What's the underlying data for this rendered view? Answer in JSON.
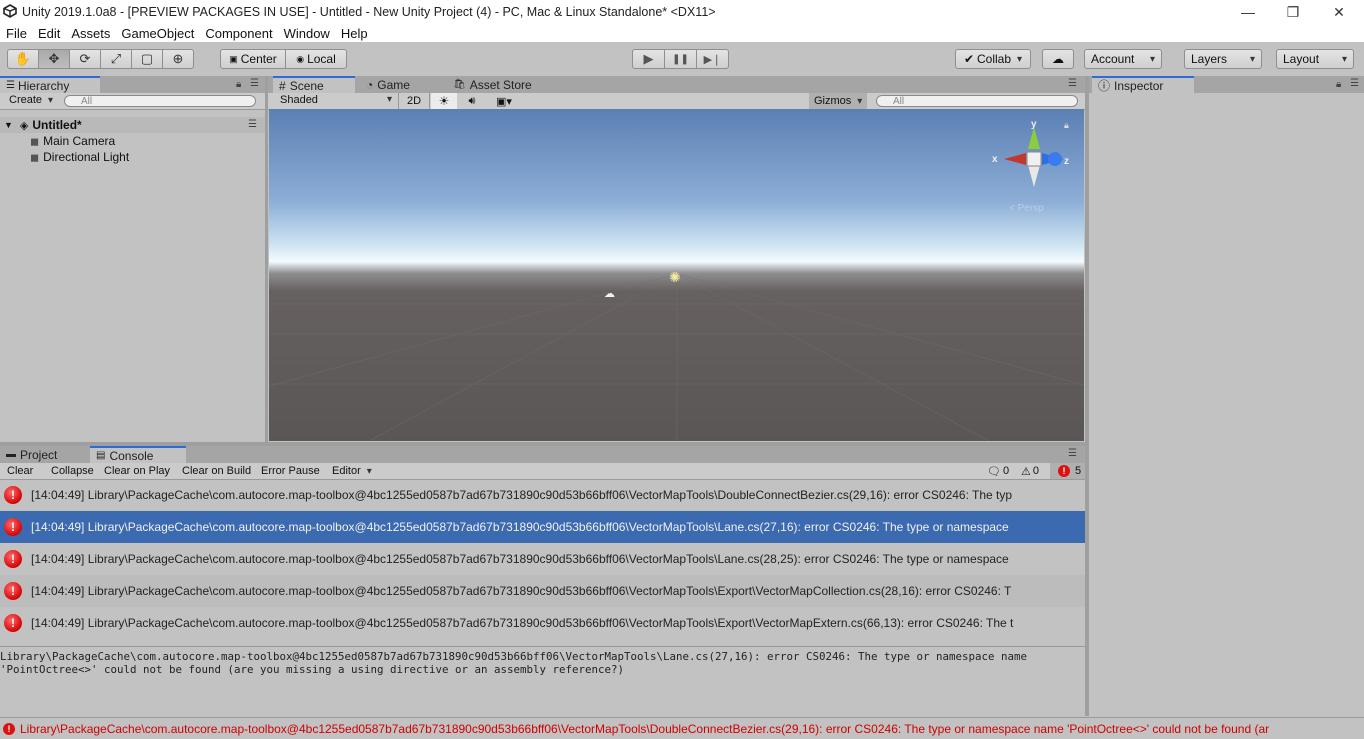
{
  "window": {
    "title": "Unity 2019.1.0a8 - [PREVIEW PACKAGES IN USE] - Untitled - New Unity Project (4) - PC, Mac & Linux Standalone* <DX11>",
    "minimize": "—",
    "restore": "❐",
    "close": "✕"
  },
  "menu": [
    "File",
    "Edit",
    "Assets",
    "GameObject",
    "Component",
    "Window",
    "Help"
  ],
  "toolbar": {
    "tools": [
      "hand-tool-icon",
      "move-tool-icon",
      "rotate-tool-icon",
      "scale-tool-icon",
      "rect-tool-icon",
      "transform-tool-icon"
    ],
    "tool_glyphs": [
      "✋",
      "✥",
      "⟳",
      "⤢",
      "▢",
      "⊕"
    ],
    "pivot_center": "Center",
    "pivot_local": "Local",
    "play": "▶",
    "pause": "❚❚",
    "step": "▶❘",
    "collab": "Collab",
    "cloud": "☁",
    "account": "Account",
    "layers": "Layers",
    "layout": "Layout"
  },
  "hierarchy": {
    "tab": "Hierarchy",
    "create": "Create",
    "search_placeholder": "All",
    "scene_name": "Untitled*",
    "items": [
      "Main Camera",
      "Directional Light"
    ]
  },
  "scene": {
    "tabs": [
      "Scene",
      "Game",
      "Asset Store"
    ],
    "shading": "Shaded",
    "mode_2d": "2D",
    "gizmos": "Gizmos",
    "search_placeholder": "All",
    "axis_y": "y",
    "axis_x": "x",
    "axis_z": "z",
    "persp": "Persp"
  },
  "inspector": {
    "tab": "Inspector"
  },
  "console": {
    "tabs": [
      "Project",
      "Console"
    ],
    "toolbar": [
      "Clear",
      "Collapse",
      "Clear on Play",
      "Clear on Build",
      "Error Pause",
      "Editor"
    ],
    "counts": {
      "info": "0",
      "warn": "0",
      "error": "5"
    },
    "rows": [
      "[14:04:49] Library\\PackageCache\\com.autocore.map-toolbox@4bc1255ed0587b7ad67b731890c90d53b66bff06\\VectorMapTools\\DoubleConnectBezier.cs(29,16): error CS0246: The typ",
      "[14:04:49] Library\\PackageCache\\com.autocore.map-toolbox@4bc1255ed0587b7ad67b731890c90d53b66bff06\\VectorMapTools\\Lane.cs(27,16): error CS0246: The type or namespace",
      "[14:04:49] Library\\PackageCache\\com.autocore.map-toolbox@4bc1255ed0587b7ad67b731890c90d53b66bff06\\VectorMapTools\\Lane.cs(28,25): error CS0246: The type or namespace",
      "[14:04:49] Library\\PackageCache\\com.autocore.map-toolbox@4bc1255ed0587b7ad67b731890c90d53b66bff06\\VectorMapTools\\Export\\VectorMapCollection.cs(28,16): error CS0246: T",
      "[14:04:49] Library\\PackageCache\\com.autocore.map-toolbox@4bc1255ed0587b7ad67b731890c90d53b66bff06\\VectorMapTools\\Export\\VectorMapExtern.cs(66,13): error CS0246: The t"
    ],
    "selected_index": 1,
    "detail_line1": "Library\\PackageCache\\com.autocore.map-toolbox@4bc1255ed0587b7ad67b731890c90d53b66bff06\\VectorMapTools\\Lane.cs(27,16): error CS0246: The type or namespace name",
    "detail_line2": "'PointOctree<>' could not be found (are you missing a using directive or an assembly reference?)"
  },
  "status": {
    "message": "Library\\PackageCache\\com.autocore.map-toolbox@4bc1255ed0587b7ad67b731890c90d53b66bff06\\VectorMapTools\\DoubleConnectBezier.cs(29,16): error CS0246: The type or namespace name 'PointOctree<>' could not be found (ar"
  },
  "colors": {
    "selection": "#3b6ab0",
    "error": "#d11111",
    "panel": "#c2c2c2",
    "tab_accent": "#2f6ad9"
  }
}
